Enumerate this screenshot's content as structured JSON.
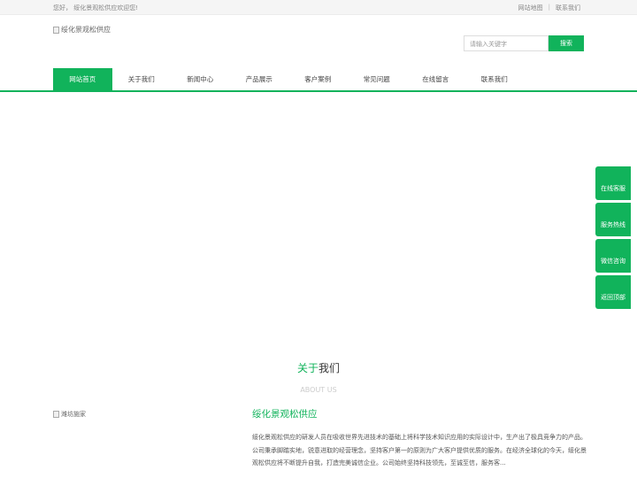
{
  "topbar": {
    "welcome": "您好， 绥化景观松供应欢迎您!",
    "sitemap": "网站地图",
    "separator": "|",
    "contact": "联系我们"
  },
  "logo": {
    "alt": "绥化景观松供应"
  },
  "search": {
    "placeholder": "请输入关键字",
    "button": "搜索"
  },
  "nav": {
    "items": [
      "网站首页",
      "关于我们",
      "新闻中心",
      "产品展示",
      "客户案例",
      "常见问题",
      "在线留言",
      "联系我们"
    ],
    "active_index": 0
  },
  "side_buttons": [
    "在线客服",
    "服务热线",
    "微信咨询",
    "返回顶部"
  ],
  "about": {
    "title_highlight": "关于",
    "title_rest": "我们",
    "subtitle": "ABOUT US",
    "image_alt": "潍坊施家",
    "company": "绥化景观松供应",
    "intro": "绥化景观松供应的研发人员在吸收世界先进技术的基础上将科学技术知识应用的实际设计中，生产出了极具竞争力的产品。公司秉承脚踏实地，锐意进取的经营理念，坚持客户第一的原则为广大客户提供优质的服务。在经济全球化的今天，绥化景观松供应将不断提升自我，打造完美诚信企业。公司始终坚持科技领先，至诚至信，服务客..."
  },
  "colors": {
    "accent": "#11b35b"
  }
}
